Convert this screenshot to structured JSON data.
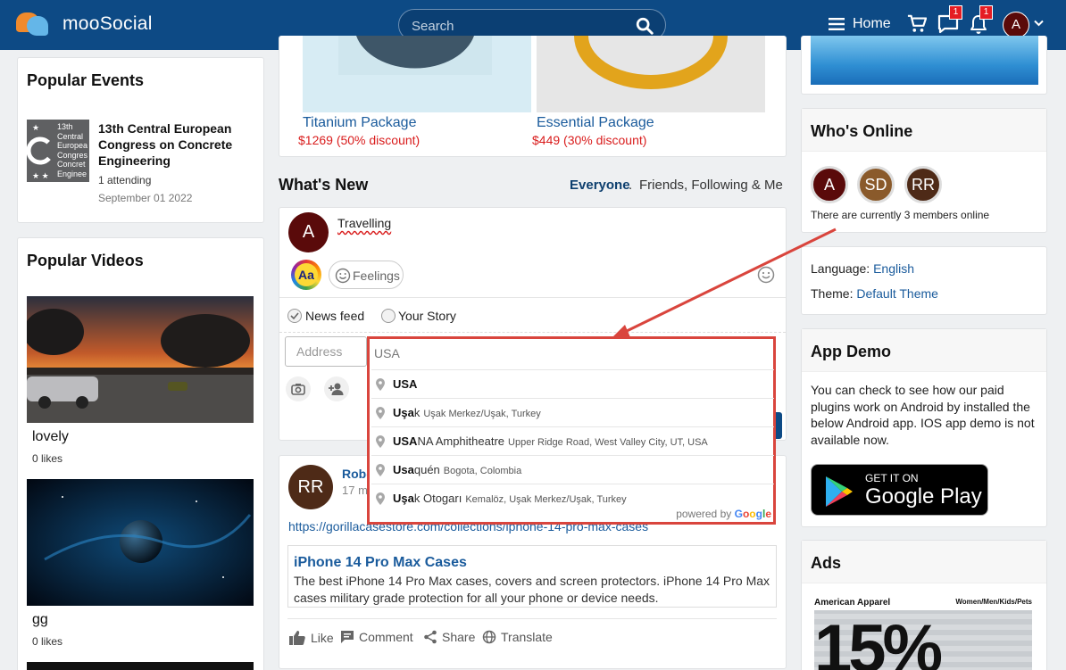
{
  "header": {
    "brand": "mooSocial",
    "search_placeholder": "Search",
    "home_label": "Home",
    "messages_badge": "1",
    "notifications_badge": "1",
    "avatar_letter": "A"
  },
  "popular_events": {
    "title": "Popular Events",
    "thumb_text": "13th Central Europea Congres Concret Enginee",
    "event": {
      "title": "13th Central European Congress on Concrete Engineering",
      "attending": "1 attending",
      "date": "September 01 2022"
    }
  },
  "popular_videos": {
    "title": "Popular Videos",
    "items": [
      {
        "title": "lovely",
        "likes": "0 likes"
      },
      {
        "title": "gg",
        "likes": "0 likes"
      }
    ]
  },
  "packages": [
    {
      "name": "Titanium Package",
      "price": "$1269 (50% discount)"
    },
    {
      "name": "Essential Package",
      "price": "$449 (30% discount)"
    }
  ],
  "whats_new": {
    "title": "What's New",
    "filter_everyone": "Everyone",
    "filter_separator": ".",
    "filter_friends": "Friends, Following & Me"
  },
  "composer": {
    "avatar_letter": "A",
    "text": "Travelling",
    "aa_label": "Aa",
    "feelings_label": "Feelings",
    "option_news_feed": "News feed",
    "option_your_story": "Your Story",
    "address_placeholder": "Address",
    "location_value": "USA"
  },
  "location_suggestions": {
    "items": [
      {
        "match": "USA",
        "rest": "",
        "sub": ""
      },
      {
        "match": "Uşa",
        "rest": "k",
        "sub": "Uşak Merkez/Uşak, Turkey"
      },
      {
        "match": "USA",
        "rest": "NA Amphitheatre",
        "sub": "Upper Ridge Road, West Valley City, UT, USA"
      },
      {
        "match": "Usa",
        "rest": "quén",
        "sub": "Bogota, Colombia"
      },
      {
        "match": "Uşa",
        "rest": "k Otogarı",
        "sub": "Kemalöz, Uşak Merkez/Uşak, Turkey"
      }
    ],
    "powered_by": "powered by",
    "google": [
      "G",
      "o",
      "o",
      "g",
      "l",
      "e"
    ]
  },
  "post": {
    "avatar_letters": "RR",
    "author_partial": "Robe",
    "time_partial": "17 m",
    "url": "https://gorillacasestore.com/collections/iphone-14-pro-max-cases",
    "link_title": "iPhone 14 Pro Max Cases",
    "link_desc": "The best iPhone 14 Pro Max cases, covers and screen protectors. iPhone 14 Pro Max cases military grade protection for all your phone or device needs.",
    "actions": {
      "like": "Like",
      "comment": "Comment",
      "share": "Share",
      "translate": "Translate"
    }
  },
  "whos_online": {
    "title": "Who's Online",
    "avatars": [
      "A",
      "SD",
      "RR"
    ],
    "summary": "There are currently 3 members online"
  },
  "settings": {
    "language_label": "Language:",
    "language_value": "English",
    "theme_label": "Theme:",
    "theme_value": "Default Theme"
  },
  "app_demo": {
    "title": "App Demo",
    "text": "You can check to see how our paid plugins work on Android by installed the below Android app. IOS app demo is not available now.",
    "badge_top": "GET IT ON",
    "badge_name": "Google Play"
  },
  "ads": {
    "title": "Ads",
    "brand": "American Apparel",
    "tagline": "Women/Men/Kids/Pets",
    "big_text": "15%"
  },
  "colors": {
    "header_bg": "#0d4a85",
    "link": "#1a5b9c",
    "price": "#d91c1c",
    "highlight_border": "#d9453d"
  }
}
